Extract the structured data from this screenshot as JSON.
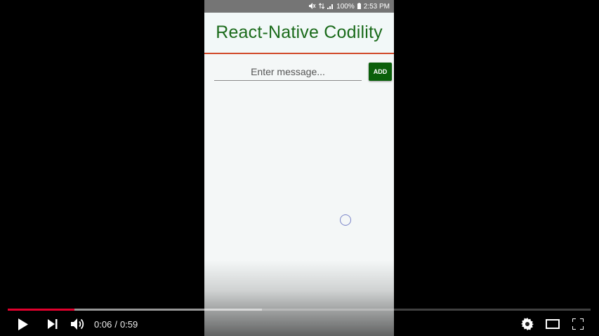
{
  "phone": {
    "status_bar": {
      "battery": "100%",
      "time": "2:53 PM"
    },
    "header": {
      "title": "React-Native Codility"
    },
    "input": {
      "placeholder": "Enter message..."
    },
    "add_button": {
      "label": "ADD"
    }
  },
  "player": {
    "current_time": "0:06",
    "separator": "/",
    "duration": "0:59",
    "progress_played": 0.114,
    "progress_buffered": 0.436,
    "icons": [
      "play-icon",
      "next-icon",
      "volume-icon",
      "settings-icon",
      "theater-mode-icon",
      "fullscreen-icon"
    ],
    "colors": {
      "progress": "#e1002d"
    }
  }
}
